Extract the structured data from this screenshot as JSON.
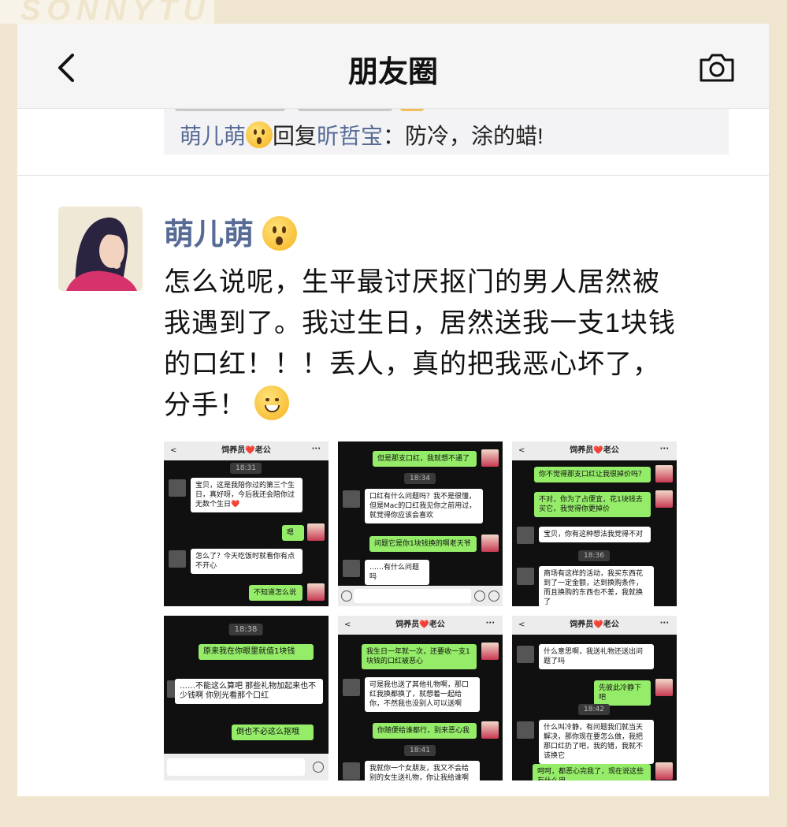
{
  "watermark": "SONNYTU",
  "nav": {
    "title": "朋友圈"
  },
  "reply": {
    "from": "萌儿萌",
    "verb": "回复",
    "to": "昕哲宝",
    "text": "：防冷，涂的蜡!"
  },
  "post": {
    "author": "萌儿萌",
    "lines": [
      "怎么说呢，生平最讨厌抠门的男人居然被",
      "我遇到了。我过生日，居然送我一支1块钱",
      "的口红！！！丢人，真的把我恶心坏了，",
      "分手！"
    ]
  },
  "screenshots": {
    "s1": {
      "header": "饲养员❤️老公",
      "time": "18:31",
      "m1": "宝贝，这是我陪你过的第三个生日，真好呀，今后我还会陪你过无数个生日❤️",
      "m2": "嗯",
      "m3": "怎么了？今天吃饭时就看你有点不开心",
      "m4": "不知道怎么说"
    },
    "s2": {
      "m1": "但是那支口红，我就想不通了",
      "time": "18:34",
      "m2": "口红有什么问题吗？我不是很懂，但是Mac的口红我见你之前用过，就觉得你应该会喜欢",
      "m3": "问题它是你1块钱换的啊老天爷",
      "m4": "……有什么问题吗"
    },
    "s3": {
      "header": "饲养员❤️老公",
      "m1": "你不觉得那支口红让我很掉价吗？",
      "m2": "不对，你为了占便宜，花1块钱去买它，我觉得你更掉价",
      "m3": "宝贝，你有这种想法我觉得不对",
      "time": "18:36",
      "m4": "商场有这样的活动，我买东西花到了一定金额，达到换购条件，而且换购的东西也不差，我就换了"
    },
    "s4": {
      "time": "18:38",
      "m1": "原来我在你眼里就值1块钱",
      "m2": "……不能这么算吧 那些礼物加起来也不少钱啊 你别光看那个口红",
      "m3": "倒也不必这么抠哦"
    },
    "s5": {
      "header": "饲养员❤️老公",
      "m1": "我生日一年就一次，还要收一支1块钱的口红被恶心",
      "m2": "可是我也送了其他礼物啊，那口红我换都换了，就想着一起给你，不然我也没别人可以送啊",
      "m3": "你随便给谁都行，别来恶心我",
      "time": "18:41",
      "m4": "我就你一个女朋友，我又不会给别的女生送礼物，你让我给谁啊"
    },
    "s6": {
      "header": "饲养员❤️老公",
      "m1": "什么意思啊，我送礼物还送出问题了吗",
      "m2": "先彼此冷静下吧",
      "time": "18:42",
      "m3": "什么叫冷静，有问题我们就当天解决，那你现在要怎么做，我把那口红扔了吧，我的错，我就不该换它",
      "m4": "呵呵，都恶心完我了，现在说这些有什么用"
    }
  }
}
